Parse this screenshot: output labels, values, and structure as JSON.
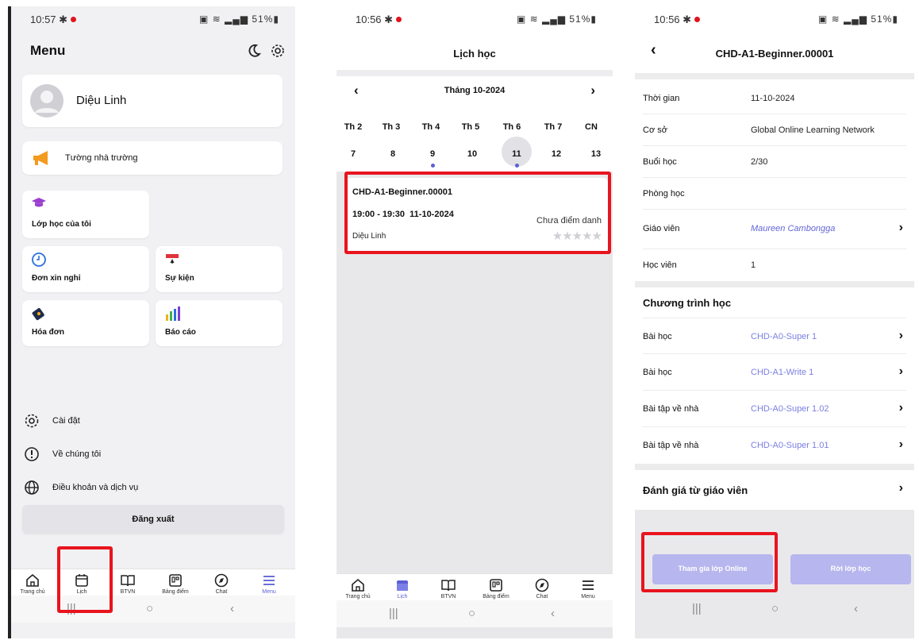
{
  "colors": {
    "accent": "#5b5fd6",
    "highlight": "#e8141e",
    "button": "#b7b6ee"
  },
  "panel_menu": {
    "status_time": "10:57",
    "status_right": "51%",
    "title": "Menu",
    "user_name": "Diệu Linh",
    "school_wall": "Tường nhà trường",
    "my_class": "Lớp học của tôi",
    "leave_request": "Đơn xin nghỉ",
    "events": "Sự kiện",
    "invoice": "Hóa đơn",
    "report": "Báo cáo",
    "settings": "Cài đặt",
    "about_us": "Về chúng tôi",
    "terms": "Điều khoản và dịch vụ",
    "logout": "Đăng xuất"
  },
  "nav": {
    "home": "Trang chủ",
    "schedule": "Lịch",
    "homework": "BTVN",
    "scoreboard": "Bảng điểm",
    "chat": "Chat",
    "menu": "Menu"
  },
  "panel_schedule": {
    "status_time": "10:56",
    "status_right": "51%",
    "title": "Lịch học",
    "month_label": "Tháng 10-2024",
    "weekdays": [
      "Th 2",
      "Th 3",
      "Th 4",
      "Th 5",
      "Th 6",
      "Th 7",
      "CN"
    ],
    "days": [
      "7",
      "8",
      "9",
      "10",
      "11",
      "12",
      "13"
    ],
    "event": {
      "class_code": "CHD-A1-Beginner.00001",
      "time": "19:00 - 19:30  11-10-2024",
      "attendance": "Chưa điểm danh",
      "teacher": "Diệu Linh",
      "stars": "★★★★★"
    }
  },
  "panel_detail": {
    "status_time": "10:56",
    "status_right": "51%",
    "title": "CHD-A1-Beginner.00001",
    "rows": [
      {
        "label": "Thời gian",
        "value": "11-10-2024"
      },
      {
        "label": "Cơ sở",
        "value": "Global Online Learning Network"
      },
      {
        "label": "Buổi học",
        "value": "2/30"
      },
      {
        "label": "Phòng học",
        "value": ""
      },
      {
        "label": "Giáo viên",
        "value": "Maureen Cambongga"
      },
      {
        "label": "Học viên",
        "value": "1"
      }
    ],
    "program_title": "Chương trình học",
    "program": [
      {
        "label": "Bài học",
        "value": "CHD-A0-Super 1"
      },
      {
        "label": "Bài học",
        "value": "CHD-A1-Write 1"
      },
      {
        "label": "Bài tập về nhà",
        "value": "CHD-A0-Super 1.02"
      },
      {
        "label": "Bài tập về nhà",
        "value": "CHD-A0-Super 1.01"
      }
    ],
    "teacher_review": "Đánh giá từ giáo viên",
    "join_online": "Tham gia lớp Online",
    "leave_class": "Rời lớp học"
  }
}
